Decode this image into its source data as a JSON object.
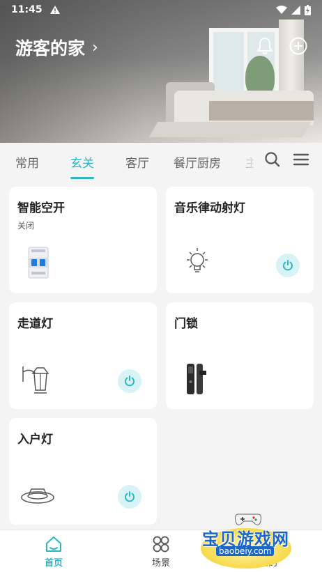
{
  "status_bar": {
    "time": "11:45"
  },
  "header": {
    "home_name": "游客的家",
    "chevron": "›"
  },
  "tabs": [
    {
      "label": "常用"
    },
    {
      "label": "玄关",
      "active": true
    },
    {
      "label": "客厅"
    },
    {
      "label": "餐厅厨房"
    },
    {
      "label": "主"
    }
  ],
  "devices": [
    {
      "name": "智能空开",
      "status": "关闭",
      "icon": "circuit-breaker-icon",
      "has_power_button": false
    },
    {
      "name": "音乐律动射灯",
      "icon": "bulb-icon",
      "has_power_button": true
    },
    {
      "name": "走道灯",
      "icon": "wall-lantern-icon",
      "has_power_button": true
    },
    {
      "name": "门锁",
      "icon": "door-lock-icon",
      "has_power_button": false
    },
    {
      "name": "入户灯",
      "icon": "downlight-icon",
      "has_power_button": true
    }
  ],
  "bottom_nav": [
    {
      "label": "首页",
      "active": true,
      "icon": "home-icon"
    },
    {
      "label": "场景",
      "icon": "scene-icon"
    },
    {
      "label": "我的",
      "icon": "profile-icon"
    }
  ],
  "watermark": {
    "title": "宝贝游戏网",
    "url": "baobeiy.com"
  },
  "colors": {
    "accent": "#2cb6c4",
    "power_bg": "#d8f3f5"
  }
}
